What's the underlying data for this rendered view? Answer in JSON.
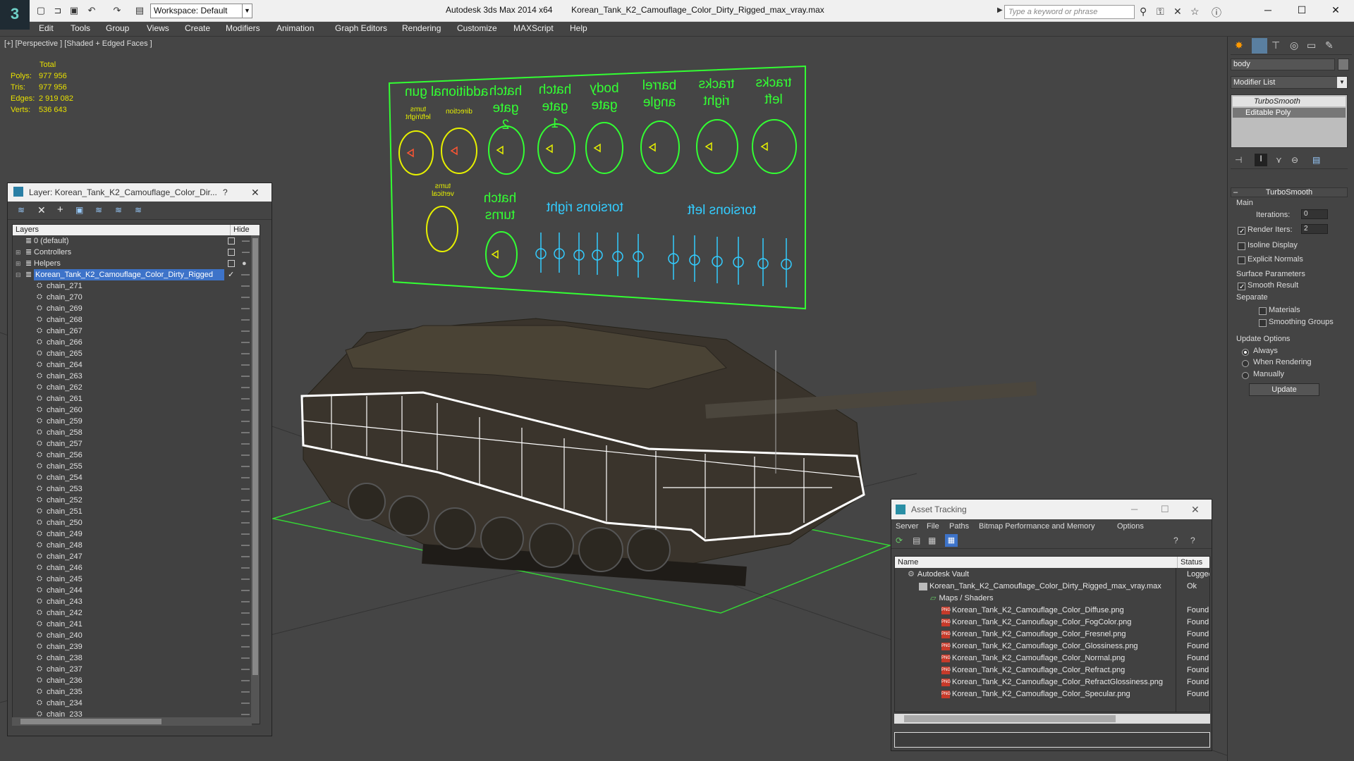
{
  "titlebar": {
    "app": "Autodesk 3ds Max 2014 x64",
    "file": "Korean_Tank_K2_Camouflage_Color_Dirty_Rigged_max_vray.max",
    "workspace": "Workspace: Default",
    "search_placeholder": "Type a keyword or phrase"
  },
  "menu": [
    "Edit",
    "Tools",
    "Group",
    "Views",
    "Create",
    "Modifiers",
    "Animation",
    "Graph Editors",
    "Rendering",
    "Customize",
    "MAXScript",
    "Help"
  ],
  "viewport": {
    "label": "[+] [Perspective ] [Shaded + Edged Faces ]",
    "stats": {
      "header": "Total",
      "polys_label": "Polys:",
      "polys": "977 956",
      "tris_label": "Tris:",
      "tris": "977 956",
      "edges_label": "Edges:",
      "edges": "2 919 082",
      "verts_label": "Verts:",
      "verts": "536 643"
    },
    "rig_labels": {
      "additional_gun": "additional gun",
      "turns_leftright": "turns left/right",
      "direction": "direction",
      "hatch_gate2": "hatch gate 2",
      "hatch_gate1": "hatch gate 1",
      "body_gate": "body gate",
      "barrel_angle": "barrel angle",
      "tracks_right": "tracks right",
      "tracks_left": "tracks left",
      "turns_vertical": "turns vertical",
      "hatch_turns": "hatch turns",
      "torsions_right": "torsions right",
      "torsions_left": "torsions left"
    }
  },
  "layer_manager": {
    "title": "Layer: Korean_Tank_K2_Camouflage_Color_Dir...",
    "help": "?",
    "col_layers": "Layers",
    "col_hide": "Hide",
    "top_layers": [
      "0 (default)",
      "Controllers",
      "Helpers"
    ],
    "selected_layer": "Korean_Tank_K2_Camouflage_Color_Dirty_Rigged",
    "children": [
      "chain_271",
      "chain_270",
      "chain_269",
      "chain_268",
      "chain_267",
      "chain_266",
      "chain_265",
      "chain_264",
      "chain_263",
      "chain_262",
      "chain_261",
      "chain_260",
      "chain_259",
      "chain_258",
      "chain_257",
      "chain_256",
      "chain_255",
      "chain_254",
      "chain_253",
      "chain_252",
      "chain_251",
      "chain_250",
      "chain_249",
      "chain_248",
      "chain_247",
      "chain_246",
      "chain_245",
      "chain_244",
      "chain_243",
      "chain_242",
      "chain_241",
      "chain_240",
      "chain_239",
      "chain_238",
      "chain_237",
      "chain_236",
      "chain_235",
      "chain_234",
      "chain_233"
    ]
  },
  "command_panel": {
    "object_name": "body",
    "modifier_list": "Modifier List",
    "stack": [
      "TurboSmooth",
      "Editable Poly"
    ],
    "rollout_title": "TurboSmooth",
    "main_label": "Main",
    "iterations_label": "Iterations:",
    "iterations": "0",
    "render_iters_label": "Render Iters:",
    "render_iters": "2",
    "isoline": "Isoline Display",
    "explicit_normals": "Explicit Normals",
    "surface_params": "Surface Parameters",
    "smooth_result": "Smooth Result",
    "separate": "Separate",
    "materials": "Materials",
    "smoothing_groups": "Smoothing Groups",
    "update_options": "Update Options",
    "always": "Always",
    "when_rendering": "When Rendering",
    "manually": "Manually",
    "update_btn": "Update"
  },
  "asset_tracking": {
    "title": "Asset Tracking",
    "menu": [
      "Server",
      "File",
      "Paths",
      "Bitmap Performance and Memory",
      "Options"
    ],
    "col_name": "Name",
    "col_status": "Status",
    "vault": "Autodesk Vault",
    "vault_status": "Logged (",
    "file": "Korean_Tank_K2_Camouflage_Color_Dirty_Rigged_max_vray.max",
    "file_status": "Ok",
    "maps": "Maps / Shaders",
    "maps_files": [
      {
        "name": "Korean_Tank_K2_Camouflage_Color_Diffuse.png",
        "status": "Found"
      },
      {
        "name": "Korean_Tank_K2_Camouflage_Color_FogColor.png",
        "status": "Found"
      },
      {
        "name": "Korean_Tank_K2_Camouflage_Color_Fresnel.png",
        "status": "Found"
      },
      {
        "name": "Korean_Tank_K2_Camouflage_Color_Glossiness.png",
        "status": "Found"
      },
      {
        "name": "Korean_Tank_K2_Camouflage_Color_Normal.png",
        "status": "Found"
      },
      {
        "name": "Korean_Tank_K2_Camouflage_Color_Refract.png",
        "status": "Found"
      },
      {
        "name": "Korean_Tank_K2_Camouflage_Color_RefractGlossiness.png",
        "status": "Found"
      },
      {
        "name": "Korean_Tank_K2_Camouflage_Color_Specular.png",
        "status": "Found"
      }
    ]
  },
  "colors": {
    "accent": "#3d73c9",
    "rig_green": "#33ff33",
    "rig_yellow": "#e6f000",
    "rig_cyan": "#33ccff",
    "stats_yellow": "#e8e000"
  }
}
